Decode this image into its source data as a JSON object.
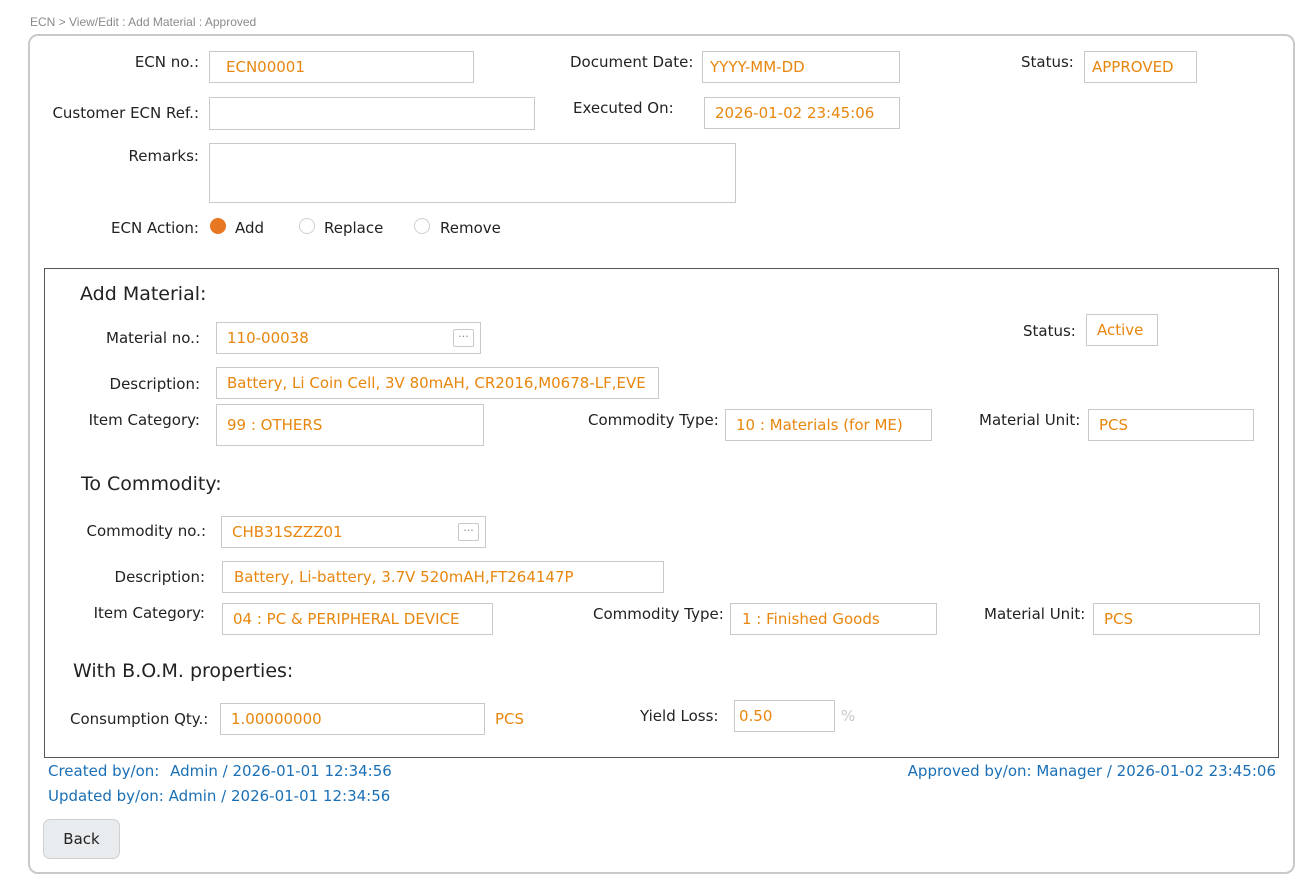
{
  "breadcrumb": "ECN > View/Edit : Add Material : Approved",
  "header": {
    "ecn_no_label": "ECN no.:",
    "ecn_no_value": "ECN00001",
    "document_date_label": "Document Date:",
    "document_date_value": "YYYY-MM-DD",
    "status_label": "Status:",
    "status_value": "APPROVED",
    "customer_ref_label": "Customer ECN Ref.:",
    "customer_ref_value": "",
    "executed_on_label": "Executed On:",
    "executed_on_value": "2026-01-02 23:45:06",
    "remarks_label": "Remarks:",
    "remarks_value": "",
    "ecn_action_label": "ECN Action:",
    "actions": [
      {
        "label": "Add",
        "selected": true
      },
      {
        "label": "Replace",
        "selected": false
      },
      {
        "label": "Remove",
        "selected": false
      }
    ]
  },
  "add_material": {
    "title": "Add Material:",
    "material_no_label": "Material no.:",
    "material_no_value": "110-00038",
    "status_label": "Status:",
    "status_value": "Active",
    "description_label": "Description:",
    "description_value": "Battery, Li Coin Cell, 3V 80mAH, CR2016,M0678-LF,EVE",
    "item_category_label": "Item Category:",
    "item_category_value": "99 : OTHERS",
    "commodity_type_label": "Commodity Type:",
    "commodity_type_value": "10 : Materials (for ME)",
    "material_unit_label": "Material Unit:",
    "material_unit_value": "PCS"
  },
  "to_commodity": {
    "title": "To Commodity:",
    "commodity_no_label": "Commodity no.:",
    "commodity_no_value": "CHB31SZZZ01",
    "description_label": "Description:",
    "description_value": "Battery, Li-battery, 3.7V 520mAH,FT264147P",
    "item_category_label": "Item Category:",
    "item_category_value": "04 : PC & PERIPHERAL DEVICE",
    "commodity_type_label": "Commodity Type:",
    "commodity_type_value": "1 : Finished Goods",
    "material_unit_label": "Material Unit:",
    "material_unit_value": "PCS"
  },
  "bom": {
    "title": "With B.O.M. properties:",
    "consumption_label": "Consumption Qty.:",
    "consumption_value": "1.00000000",
    "consumption_unit": "PCS",
    "yield_loss_label": "Yield Loss:",
    "yield_loss_value": "0.50",
    "yield_loss_unit": "%"
  },
  "footer": {
    "created_label": "Created by/on:",
    "created_value": "Admin / 2026-01-01 12:34:56",
    "updated_label": "Updated by/on:",
    "updated_value": "Admin / 2026-01-01 12:34:56",
    "approved_label": "Approved by/on:",
    "approved_value": "Manager / 2026-01-02 23:45:06",
    "back_label": "Back"
  },
  "colors": {
    "value_text": "#e8860d",
    "link_text": "#1a6fb5",
    "radio_selected": "#e87722"
  },
  "icons": {
    "lookup": "ellipsis-icon"
  }
}
